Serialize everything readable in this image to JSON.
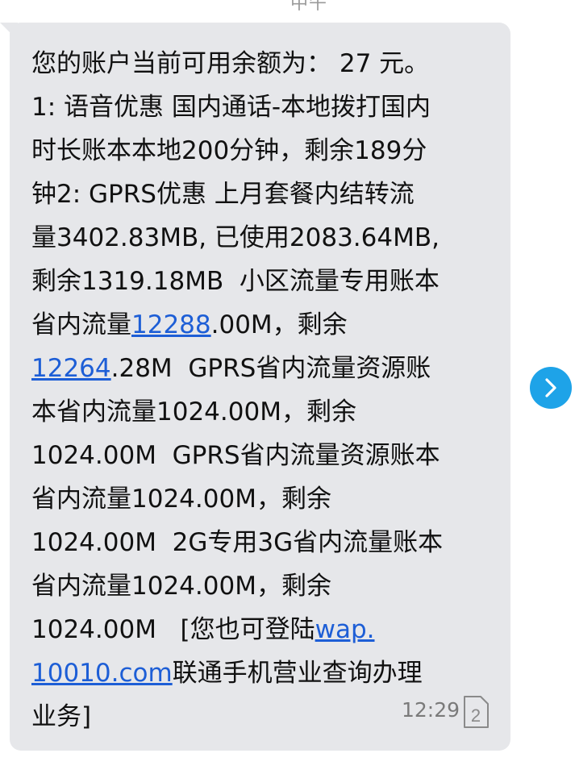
{
  "top_fragment": "中午",
  "message": {
    "lines": [
      [
        {
          "text": "您的账户当前可用余额为： 27 元。"
        }
      ],
      [
        {
          "text": "1: 语音优惠 国内通话-本地拨打国内"
        }
      ],
      [
        {
          "text": "时长账本本地200分钟，剩余189分"
        }
      ],
      [
        {
          "text": "钟2: GPRS优惠 上月套餐内结转流"
        }
      ],
      [
        {
          "text": "量3402.83MB, 已使用2083.64MB,"
        }
      ],
      [
        {
          "text": "剩余1319.18MB  小区流量专用账本"
        }
      ],
      [
        {
          "text": "省内流量"
        },
        {
          "text": "12288",
          "link": true
        },
        {
          "text": ".00M，剩余"
        }
      ],
      [
        {
          "text": "12264",
          "link": true
        },
        {
          "text": ".28M  GPRS省内流量资源账"
        }
      ],
      [
        {
          "text": "本省内流量1024.00M，剩余"
        }
      ],
      [
        {
          "text": "1024.00M  GPRS省内流量资源账本"
        }
      ],
      [
        {
          "text": "省内流量1024.00M，剩余"
        }
      ],
      [
        {
          "text": "1024.00M  2G专用3G省内流量账本"
        }
      ],
      [
        {
          "text": "省内流量1024.00M，剩余"
        }
      ],
      [
        {
          "text": "1024.00M   [您也可登陆"
        },
        {
          "text": "wap.",
          "link": true
        }
      ],
      [
        {
          "text": "10010.com",
          "link": true
        },
        {
          "text": "联通手机营业查询办理"
        }
      ],
      [
        {
          "text": "业务]"
        }
      ]
    ],
    "time": "12:29",
    "sim_slot": "2",
    "sim_icon": "sim-card-icon"
  },
  "forward_button": {
    "icon": "chevron-right-icon"
  },
  "colors": {
    "bubble": "#e6e7ea",
    "link": "#1d5ed6",
    "forward_button": "#1ea3e8",
    "text": "#111111",
    "time": "#7a7a7a"
  }
}
